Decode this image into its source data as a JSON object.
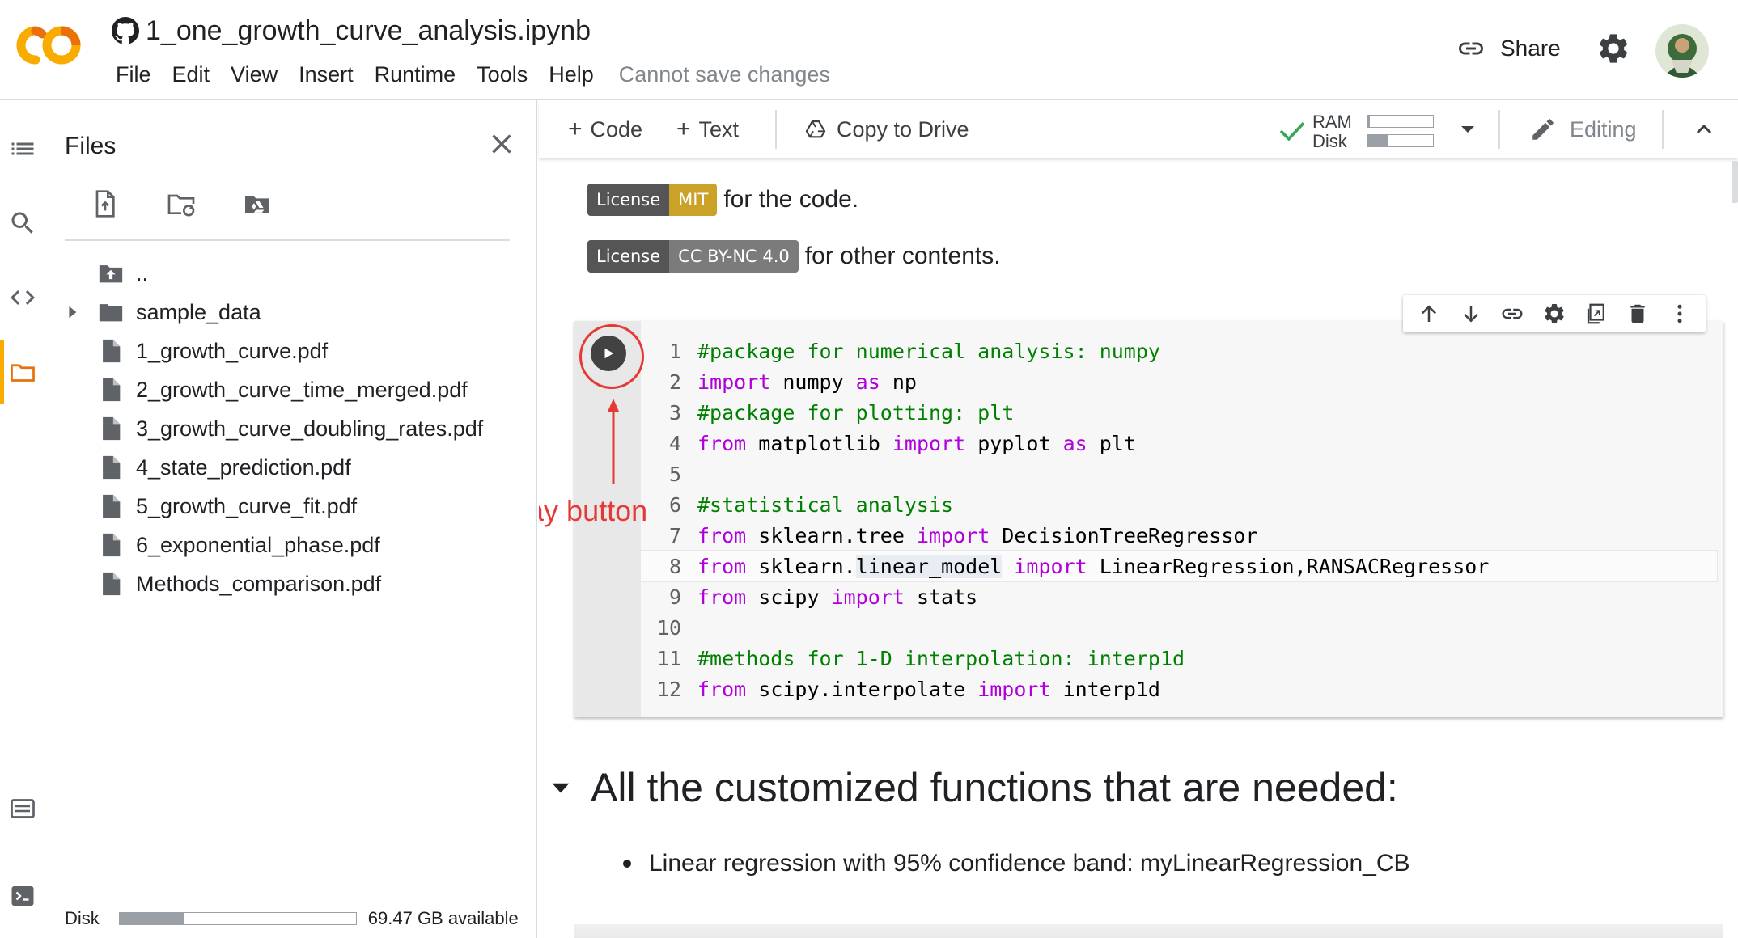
{
  "app": {
    "notebook_title": "1_one_growth_curve_analysis.ipynb",
    "save_status": "Cannot save changes",
    "share_label": "Share"
  },
  "menu": [
    "File",
    "Edit",
    "View",
    "Insert",
    "Runtime",
    "Tools",
    "Help"
  ],
  "files_panel": {
    "title": "Files",
    "parent_dir": "..",
    "items": [
      {
        "name": "sample_data",
        "type": "folder"
      },
      {
        "name": "1_growth_curve.pdf",
        "type": "file"
      },
      {
        "name": "2_growth_curve_time_merged.pdf",
        "type": "file"
      },
      {
        "name": "3_growth_curve_doubling_rates.pdf",
        "type": "file"
      },
      {
        "name": "4_state_prediction.pdf",
        "type": "file"
      },
      {
        "name": "5_growth_curve_fit.pdf",
        "type": "file"
      },
      {
        "name": "6_exponential_phase.pdf",
        "type": "file"
      },
      {
        "name": "Methods_comparison.pdf",
        "type": "file"
      }
    ],
    "disk_label": "Disk",
    "disk_available": "69.47 GB available",
    "disk_used_fraction": 0.27
  },
  "toolbar": {
    "code_label": "Code",
    "text_label": "Text",
    "copy_to_drive_label": "Copy to Drive",
    "ram_label": "RAM",
    "disk_label": "Disk",
    "ram_used_fraction": 0.02,
    "disk_used_fraction": 0.3,
    "editing_label": "Editing"
  },
  "badges": [
    {
      "left": "License",
      "right": "MIT",
      "right_color": "#c9a227",
      "text": "for the code."
    },
    {
      "left": "License",
      "right": "CC BY-NC 4.0",
      "right_color": "#7b7b7b",
      "text": "for other contents."
    }
  ],
  "code_cell": {
    "lines": [
      {
        "n": "1",
        "parts": [
          [
            "c",
            "#package for numerical analysis: numpy"
          ]
        ]
      },
      {
        "n": "2",
        "parts": [
          [
            "k",
            "import"
          ],
          [
            "t",
            " numpy "
          ],
          [
            "k",
            "as"
          ],
          [
            "t",
            " np"
          ]
        ]
      },
      {
        "n": "3",
        "parts": [
          [
            "c",
            "#package for plotting: plt"
          ]
        ]
      },
      {
        "n": "4",
        "parts": [
          [
            "k",
            "from"
          ],
          [
            "t",
            " matplotlib "
          ],
          [
            "k",
            "import"
          ],
          [
            "t",
            " pyplot "
          ],
          [
            "k",
            "as"
          ],
          [
            "t",
            " plt"
          ]
        ]
      },
      {
        "n": "5",
        "parts": []
      },
      {
        "n": "6",
        "parts": [
          [
            "c",
            "#statistical analysis"
          ]
        ]
      },
      {
        "n": "7",
        "parts": [
          [
            "k",
            "from"
          ],
          [
            "t",
            " sklearn.tree "
          ],
          [
            "k",
            "import"
          ],
          [
            "t",
            " DecisionTreeRegressor"
          ]
        ]
      },
      {
        "n": "8",
        "parts": [
          [
            "k",
            "from"
          ],
          [
            "t",
            " sklearn."
          ],
          [
            "h",
            "linear_model"
          ],
          [
            "t",
            " "
          ],
          [
            "k",
            "import"
          ],
          [
            "t",
            " LinearRegression,RANSACRegressor"
          ]
        ]
      },
      {
        "n": "9",
        "parts": [
          [
            "k",
            "from"
          ],
          [
            "t",
            " scipy "
          ],
          [
            "k",
            "import"
          ],
          [
            "t",
            " stats"
          ]
        ]
      },
      {
        "n": "10",
        "parts": []
      },
      {
        "n": "11",
        "parts": [
          [
            "c",
            "#methods for 1-D interpolation: interp1d"
          ]
        ]
      },
      {
        "n": "12",
        "parts": [
          [
            "k",
            "from"
          ],
          [
            "t",
            " scipy.interpolate "
          ],
          [
            "k",
            "import"
          ],
          [
            "t",
            " interp1d"
          ]
        ]
      }
    ],
    "highlighted_line": 8
  },
  "annotation": {
    "label": "play button",
    "color": "#e53935"
  },
  "markdown": {
    "heading": "All the customized functions that are needed:",
    "bullets": [
      "Linear regression with 95% confidence band: myLinearRegression_CB"
    ]
  },
  "colors": {
    "accent_orange": "#f9ab00",
    "check_green": "#34a853",
    "comment_green": "#008000",
    "keyword_purple": "#af00db"
  }
}
